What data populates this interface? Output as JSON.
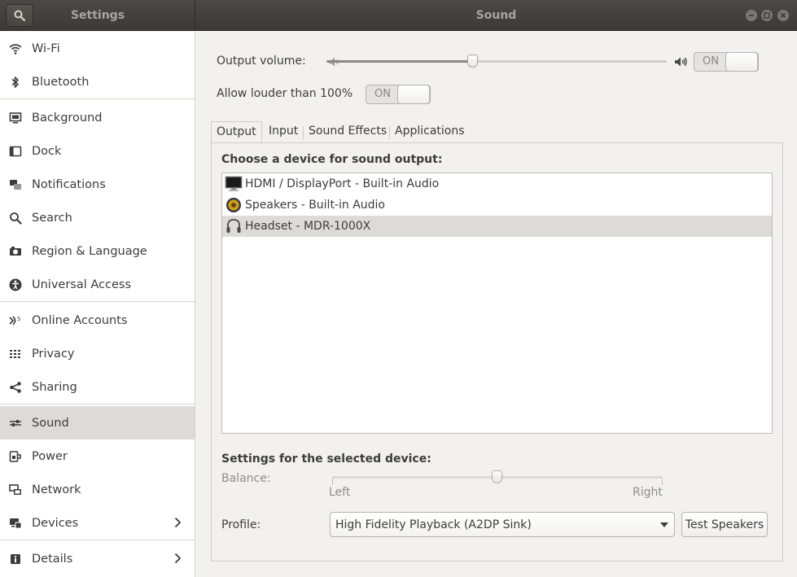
{
  "header": {
    "left_title": "Settings",
    "main_title": "Sound",
    "search_icon": "search-icon",
    "window_controls": [
      "minimize-icon",
      "maximize-icon",
      "close-icon"
    ]
  },
  "sidebar": {
    "items": [
      {
        "label": "Wi-Fi",
        "icon": "wifi-icon"
      },
      {
        "label": "Bluetooth",
        "icon": "bluetooth-icon"
      },
      {
        "label": "Background",
        "icon": "background-icon"
      },
      {
        "label": "Dock",
        "icon": "dock-icon"
      },
      {
        "label": "Notifications",
        "icon": "notifications-icon"
      },
      {
        "label": "Search",
        "icon": "search-icon"
      },
      {
        "label": "Region & Language",
        "icon": "region-icon"
      },
      {
        "label": "Universal Access",
        "icon": "universal-access-icon"
      },
      {
        "label": "Online Accounts",
        "icon": "online-accounts-icon"
      },
      {
        "label": "Privacy",
        "icon": "privacy-icon"
      },
      {
        "label": "Sharing",
        "icon": "sharing-icon"
      },
      {
        "label": "Sound",
        "icon": "sound-icon",
        "selected": true
      },
      {
        "label": "Power",
        "icon": "power-icon"
      },
      {
        "label": "Network",
        "icon": "network-icon"
      },
      {
        "label": "Devices",
        "icon": "devices-icon",
        "has_children": true
      },
      {
        "label": "Details",
        "icon": "details-icon",
        "has_children": true
      }
    ]
  },
  "sound": {
    "output_volume_label": "Output volume:",
    "output_volume_level": 0.43,
    "output_switch": "ON",
    "allow_louder_label": "Allow louder than 100%",
    "allow_louder_switch": "ON",
    "tabs": [
      {
        "label": "Output",
        "active": true
      },
      {
        "label": "Input"
      },
      {
        "label": "Sound Effects"
      },
      {
        "label": "Applications"
      }
    ],
    "choose_device_heading": "Choose a device for sound output:",
    "devices": [
      {
        "label": "HDMI / DisplayPort - Built-in Audio",
        "icon": "monitor-icon"
      },
      {
        "label": "Speakers - Built-in Audio",
        "icon": "speaker-icon"
      },
      {
        "label": "Headset - MDR-1000X",
        "icon": "headset-icon",
        "selected": true
      }
    ],
    "settings_heading": "Settings for the selected device:",
    "balance_label": "Balance:",
    "balance_value": 0.5,
    "balance_left": "Left",
    "balance_right": "Right",
    "profile_label": "Profile:",
    "profile_value": "High Fidelity Playback (A2DP Sink)",
    "test_speakers_label": "Test Speakers"
  },
  "colors": {
    "header_bg": "#3d3c38",
    "sidebar_selected": "#dcdbd7",
    "window_bg": "#f2f1f0"
  }
}
